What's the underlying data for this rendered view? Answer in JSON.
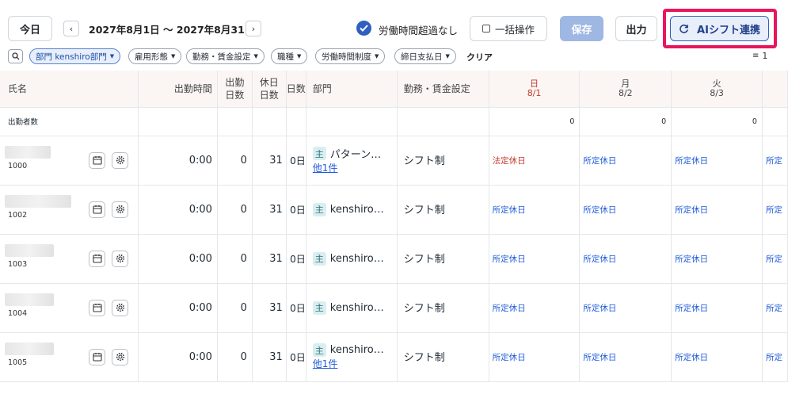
{
  "toolbar": {
    "today_label": "今日",
    "date_range": "2027年8月1日 〜 2027年8月31日",
    "prev_icon": "chevron-left-icon",
    "next_icon": "chevron-right-icon",
    "overtime_label": "労働時間超過なし",
    "overtime_checked": true,
    "bulk_label": "一括操作",
    "save_label": "保存",
    "export_label": "出力",
    "ai_shift_label": "AIシフト連携"
  },
  "filters": {
    "chips": [
      "部門 kenshiro部門",
      "雇用形態",
      "勤務・賃金設定",
      "職種",
      "労働時間制度",
      "締日支払日"
    ],
    "clear_label": "クリア",
    "sort_count": "1"
  },
  "table": {
    "headers": {
      "name": "氏名",
      "work_time": "出勤時間",
      "work_days": "出勤\n日数",
      "holiday_days": "休日\n日数",
      "partial": "日数",
      "department": "部門",
      "wage_setting": "勤務・賃金設定"
    },
    "days": [
      {
        "dow": "日",
        "date": "8/1",
        "color": "#c0392b"
      },
      {
        "dow": "月",
        "date": "8/2",
        "color": "#555555"
      },
      {
        "dow": "火",
        "date": "8/3",
        "color": "#555555"
      }
    ],
    "summary": {
      "label": "出勤者数",
      "counts": [
        "0",
        "0",
        "0"
      ]
    },
    "rows": [
      {
        "id": "1000",
        "work_time": "0:00",
        "work_days": "0",
        "holiday_days": "31",
        "partial": "0日",
        "badge": "主",
        "dept": "パターン…",
        "dept_more": "他1件",
        "wage": "シフト制",
        "cells": [
          "法定休日",
          "所定休日",
          "所定休日",
          "所定"
        ]
      },
      {
        "id": "1002",
        "work_time": "0:00",
        "work_days": "0",
        "holiday_days": "31",
        "partial": "0日",
        "badge": "主",
        "dept": "kenshiro…",
        "dept_more": "",
        "wage": "シフト制",
        "cells": [
          "所定休日",
          "所定休日",
          "所定休日",
          "所定"
        ]
      },
      {
        "id": "1003",
        "work_time": "0:00",
        "work_days": "0",
        "holiday_days": "31",
        "partial": "0日",
        "badge": "主",
        "dept": "kenshiro…",
        "dept_more": "",
        "wage": "シフト制",
        "cells": [
          "所定休日",
          "所定休日",
          "所定休日",
          "所定"
        ]
      },
      {
        "id": "1004",
        "work_time": "0:00",
        "work_days": "0",
        "holiday_days": "31",
        "partial": "0日",
        "badge": "主",
        "dept": "kenshiro…",
        "dept_more": "",
        "wage": "シフト制",
        "cells": [
          "所定休日",
          "所定休日",
          "所定休日",
          "所定"
        ]
      },
      {
        "id": "1005",
        "work_time": "0:00",
        "work_days": "0",
        "holiday_days": "31",
        "partial": "0日",
        "badge": "主",
        "dept": "kenshiro…",
        "dept_more": "他1件",
        "wage": "シフト制",
        "cells": [
          "所定休日",
          "所定休日",
          "所定休日",
          "所定"
        ]
      }
    ]
  },
  "colors": {
    "highlight_border": "#e8175d",
    "primary_blue": "#2f5fbf",
    "save_disabled": "#9fb7e3"
  }
}
